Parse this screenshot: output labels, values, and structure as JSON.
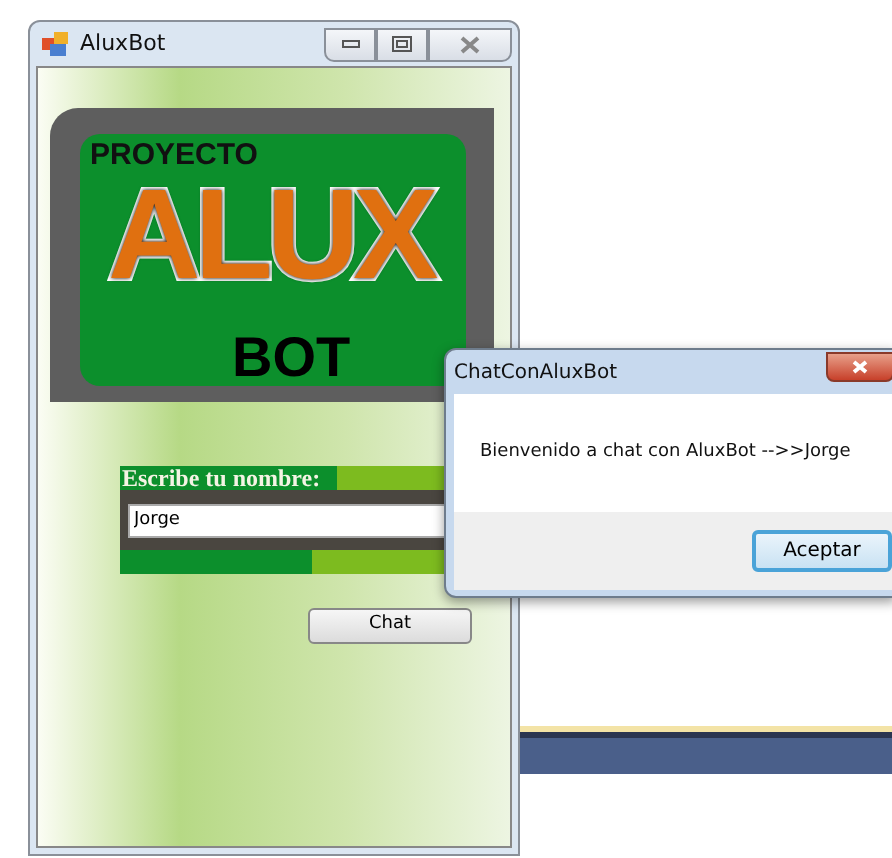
{
  "main_window": {
    "title": "AluxBot",
    "logo": {
      "line_1": "PROYECTO",
      "line_2": "ALUX",
      "line_3": "BOT"
    },
    "name_label": "Escribe tu nombre:",
    "name_field": {
      "value": "Jorge"
    },
    "chat_button": "Chat"
  },
  "dialog": {
    "title": "ChatConAluxBot",
    "message": "Bienvenido a chat con AluxBot -->>Jorge",
    "ok_button": "Aceptar"
  }
}
